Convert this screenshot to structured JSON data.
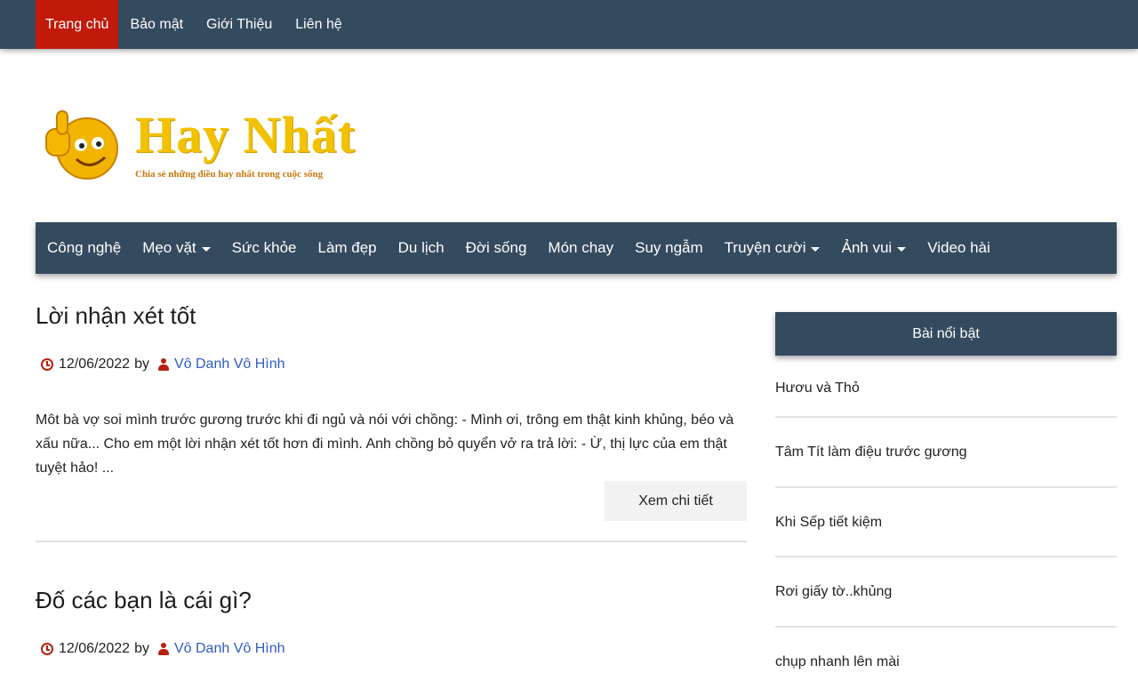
{
  "topnav": {
    "items": [
      "Trang chủ",
      "Bảo mật",
      "Giới Thiệu",
      "Liên hệ"
    ]
  },
  "logo": {
    "title": "Hay Nhất",
    "tagline": "Chia sẻ những điều hay nhất trong cuộc sống"
  },
  "mainnav": {
    "items": [
      {
        "label": "Công nghệ"
      },
      {
        "label": "Mẹo vặt",
        "dropdown": true
      },
      {
        "label": "Sức khỏe"
      },
      {
        "label": "Làm đẹp"
      },
      {
        "label": "Du lịch"
      },
      {
        "label": "Đời sống"
      },
      {
        "label": "Món chay"
      },
      {
        "label": "Suy ngẫm"
      },
      {
        "label": "Truyện cười",
        "dropdown": true
      },
      {
        "label": "Ảnh vui",
        "dropdown": true
      },
      {
        "label": "Video hài"
      }
    ]
  },
  "posts": [
    {
      "title": "Lời nhận xét tốt",
      "date": "12/06/2022",
      "by": "by",
      "author": "Vô Danh Vô Hình",
      "excerpt": "Môt bà vợ soi mình trước gương trước khi đi ngủ và nói với chồng: - Mình ơi, trông em thật kinh khủng, béo và xấu nữa... Cho em một lời nhận xét tốt hơn đi mình. Anh chồng bỏ quyển vở ra trả lời: - Ừ, thị lực của em thật tuyệt hảo!   ...",
      "readmore": "Xem chi tiết"
    },
    {
      "title": "Đố các bạn là cái gì?",
      "date": "12/06/2022",
      "by": "by",
      "author": "Vô Danh Vô Hình"
    }
  ],
  "sidebar": {
    "title": "Bài nổi bật",
    "items": [
      "Hươu và Thỏ",
      "Tâm Tít làm điệu trước gương",
      "Khi Sếp tiết kiệm",
      "Rơi giấy tờ..khủng",
      "chụp nhanh lên mài"
    ]
  },
  "colors": {
    "nav_bg": "#344a5f",
    "active_tab": "#c01a0a",
    "logo_yellow": "#f2c200",
    "author_link": "#2f5cc7",
    "icon_red": "#b82010"
  }
}
